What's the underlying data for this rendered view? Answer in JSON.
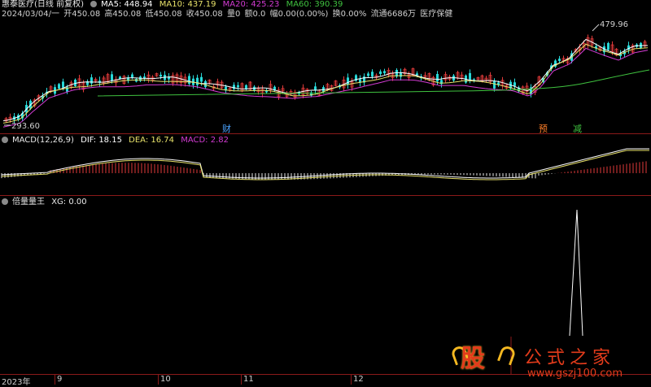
{
  "header": {
    "stock": "惠泰医疗",
    "period": "(日线 前复权)",
    "ma": [
      {
        "label": "MA5: 448.94",
        "color": "#ffffff"
      },
      {
        "label": "MA10: 437.19",
        "color": "#e8e26a"
      },
      {
        "label": "MA20: 425.23",
        "color": "#d33bd3"
      },
      {
        "label": "MA60: 390.39",
        "color": "#3fc23f"
      }
    ]
  },
  "info_line": {
    "date": "2024/03/04/一",
    "open": "开450.08",
    "high": "高450.08",
    "low": "低450.08",
    "close": "收450.08",
    "vol": "量0",
    "amount": "额0.0",
    "change": "幅0.00(0.00%)",
    "turnover": "换0.00%",
    "float": "流通6686万",
    "industry": "医疗保健"
  },
  "price_marks": {
    "high_label": "479.96",
    "low_label": "293.60"
  },
  "event_marks": [
    {
      "label": "财",
      "color": "#4aa3ff"
    },
    {
      "label": "预",
      "color": "#ff7f27"
    },
    {
      "label": "减",
      "color": "#3fc23f"
    }
  ],
  "macd": {
    "title": "MACD(12,26,9)",
    "dif": "DIF: 18.15",
    "dea": "DEA: 16.74",
    "macd": "MACD: 2.82",
    "colors": {
      "dif": "#ffffff",
      "dea": "#e8e26a",
      "macd": "#d33bd3"
    }
  },
  "indicator": {
    "name": "倍量量王",
    "xg": "XG: 0.00"
  },
  "x_axis": {
    "labels": [
      "2023年",
      "9",
      "10",
      "11",
      "12"
    ]
  },
  "watermark": {
    "big": "股",
    "title": "公式之家",
    "url": "www.gszj100.com"
  },
  "colors": {
    "up": "#e03a3a",
    "down": "#28d8d8",
    "separator": "#8b1a1a",
    "ma5": "#ffffff",
    "ma10": "#e8e26a",
    "ma20": "#d33bd3",
    "ma60": "#3fc23f"
  }
}
